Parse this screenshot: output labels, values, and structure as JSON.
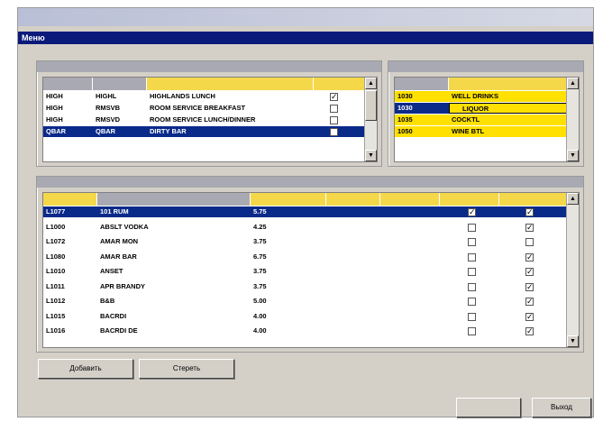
{
  "window": {
    "title": "",
    "subtitle": "Меню"
  },
  "menus_panel": {
    "caption": "",
    "columns": [
      "",
      "",
      "",
      ""
    ],
    "rows": [
      {
        "code": "HIGH",
        "short": "HIGHL",
        "name": "HIGHLANDS LUNCH",
        "checked": true,
        "selected": false
      },
      {
        "code": "HIGH",
        "short": "RMSVB",
        "name": "ROOM SERVICE BREAKFAST",
        "checked": false,
        "selected": false
      },
      {
        "code": "HIGH",
        "short": "RMSVD",
        "name": "ROOM SERVICE LUNCH/DINNER",
        "checked": false,
        "selected": false
      },
      {
        "code": "QBAR",
        "short": "QBAR",
        "name": "DIRTY BAR",
        "checked": false,
        "selected": true
      }
    ]
  },
  "groups_panel": {
    "caption": "",
    "columns": [
      "",
      ""
    ],
    "rows": [
      {
        "code": "1030",
        "name": "WELL DRINKS",
        "selected": false
      },
      {
        "code": "1030",
        "name": "LIQUOR",
        "selected": true
      },
      {
        "code": "1035",
        "name": "COCKTL",
        "selected": false
      },
      {
        "code": "1050",
        "name": "WINE BTL",
        "selected": false
      }
    ]
  },
  "items_panel": {
    "caption": "",
    "columns": [
      "",
      "",
      "",
      "",
      "",
      "",
      ""
    ],
    "rows": [
      {
        "code": "L1077",
        "name": "101 RUM",
        "price": "5.75",
        "c1": true,
        "c2": true,
        "selected": true
      },
      {
        "code": "L1000",
        "name": "ABSLT VODKA",
        "price": "4.25",
        "c1": false,
        "c2": true,
        "selected": false
      },
      {
        "code": "L1072",
        "name": "AMAR MON",
        "price": "3.75",
        "c1": false,
        "c2": false,
        "selected": false
      },
      {
        "code": "L1080",
        "name": "AMAR BAR",
        "price": "6.75",
        "c1": false,
        "c2": true,
        "selected": false
      },
      {
        "code": "L1010",
        "name": "ANSET",
        "price": "3.75",
        "c1": false,
        "c2": true,
        "selected": false
      },
      {
        "code": "L1011",
        "name": "APR BRANDY",
        "price": "3.75",
        "c1": false,
        "c2": true,
        "selected": false
      },
      {
        "code": "L1012",
        "name": "B&B",
        "price": "5.00",
        "c1": false,
        "c2": true,
        "selected": false
      },
      {
        "code": "L1015",
        "name": "BACRDI",
        "price": "4.00",
        "c1": false,
        "c2": true,
        "selected": false
      },
      {
        "code": "L1016",
        "name": "BACRDI DE",
        "price": "4.00",
        "c1": false,
        "c2": true,
        "selected": false
      }
    ]
  },
  "buttons": {
    "add": "Добавить",
    "delete": "Стереть",
    "ok": "",
    "close": "Выход"
  },
  "colors": {
    "header_grey": "#a9a9b3",
    "header_yellow": "#f5d84a",
    "selection": "#0a2a8a",
    "subbar": "#0a1a7a",
    "yellow_row": "#ffe000"
  }
}
